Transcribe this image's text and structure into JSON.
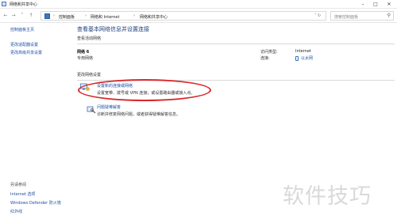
{
  "window": {
    "title": "网络和共享中心"
  },
  "address_bar": {
    "crumbs": [
      "控制面板",
      "网络和 Internet",
      "网络和共享中心"
    ],
    "search_placeholder": "搜索控制面板"
  },
  "sidebar": {
    "links": [
      "控制面板主页",
      "更改适配器设置",
      "更改高级共享设置"
    ],
    "see_also_heading": "另请参阅",
    "see_also": [
      "Internet 选项",
      "Windows Defender 防火墙",
      "红外线"
    ]
  },
  "main": {
    "page_title": "查看基本网络信息并设置连接",
    "active_networks_heading": "查看活动网络",
    "network": {
      "name": "网络 6",
      "type": "专用网络",
      "access_type_label": "访问类型:",
      "access_type_value": "Internet",
      "connections_label": "连接:",
      "connections_value": "以太网"
    },
    "change_settings_heading": "更改网络设置",
    "tasks": [
      {
        "link": "设置新的连接或网络",
        "desc": "设置宽带、拨号或 VPN 连接；或设置路由器或接入点。"
      },
      {
        "link": "问题疑难解答",
        "desc": "诊断并修复网络问题，或者获得疑难解答信息。"
      }
    ]
  },
  "watermark": "软件技巧",
  "colors": {
    "link": "#1f4fa3",
    "title_blue": "#1e3f7a",
    "highlight_red": "#d8262a"
  }
}
